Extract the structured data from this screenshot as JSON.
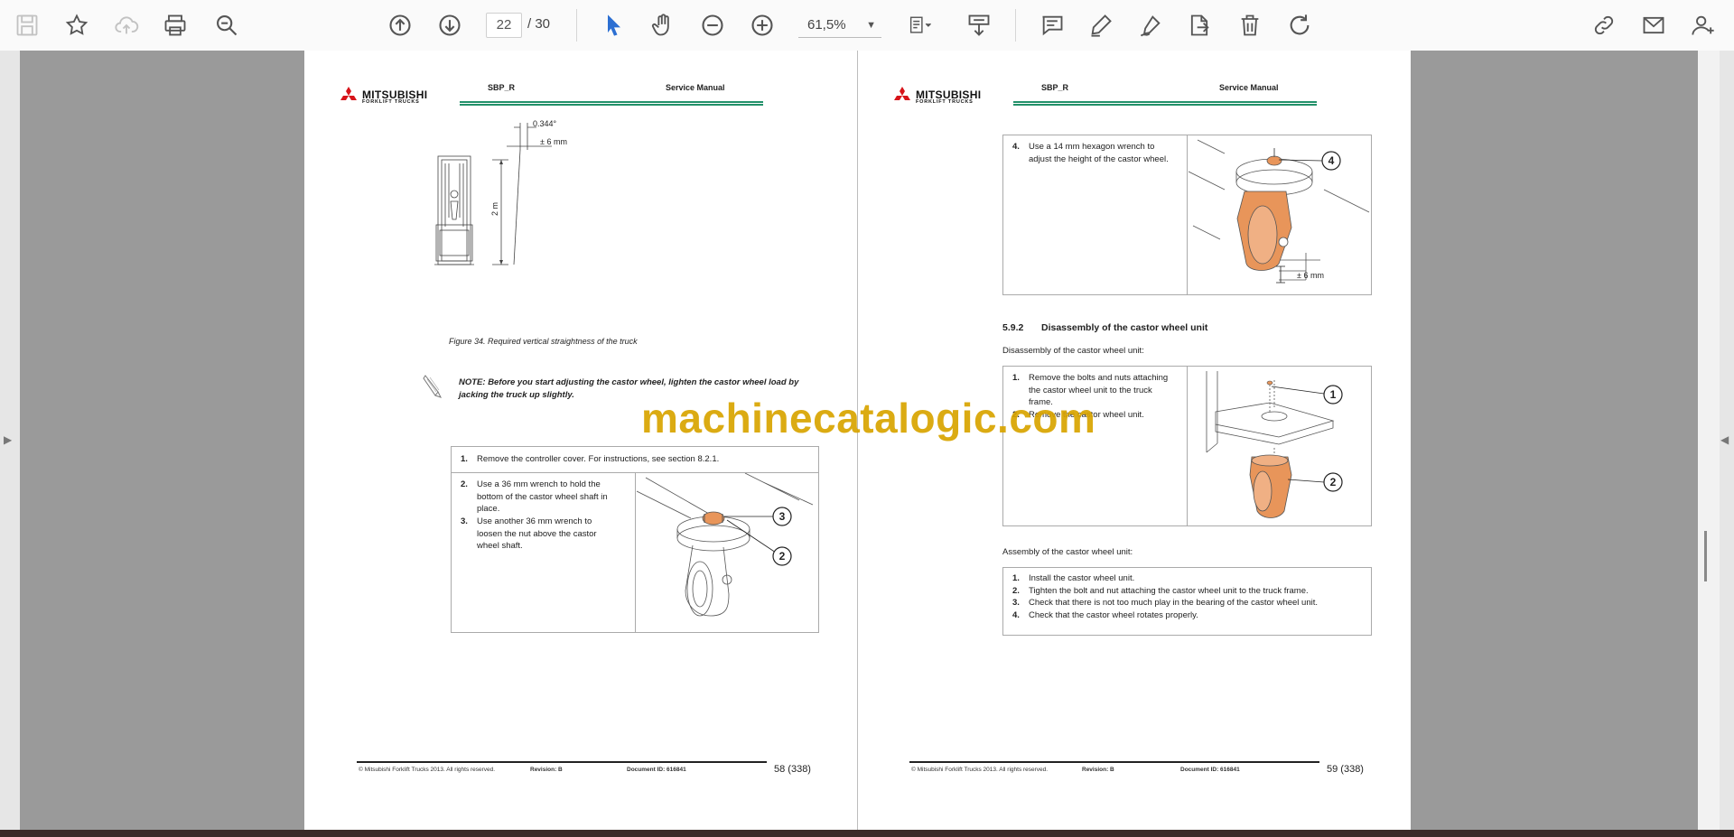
{
  "toolbar": {
    "page_current": "22",
    "page_total": "/ 30",
    "zoom": "61,5%",
    "icons": [
      "save-icon",
      "star-icon",
      "cloud-upload-icon",
      "print-icon",
      "zoom-search-icon",
      "page-up-icon",
      "page-down-icon",
      "select-cursor-icon",
      "hand-icon",
      "zoom-out-icon",
      "zoom-in-icon",
      "page-fit-icon",
      "scroll-mode-icon",
      "comment-icon",
      "highlight-pen-icon",
      "sign-icon",
      "export-icon",
      "delete-icon",
      "rotate-icon",
      "share-link-icon",
      "email-icon",
      "add-user-icon"
    ]
  },
  "left_page": {
    "brand_line1": "MITSUBISHI",
    "brand_line2": "FORKLIFT TRUCKS",
    "doc_code": "SBP_R",
    "doc_title": "Service Manual",
    "figure_dim_top": "0.344°",
    "figure_dim_tol": "± 6 mm",
    "figure_dim_height": "2 m",
    "figure_caption": "Figure 34. Required vertical straightness of the truck",
    "note_line1": "NOTE: Before you start adjusting the castor wheel, lighten the castor wheel load by",
    "note_line2": "jacking the truck up slightly.",
    "step1_num": "1.",
    "step1_text": "Remove the controller cover. For instructions, see section 8.2.1.",
    "step2_num": "2.",
    "step2_lines": [
      "Use a 36 mm wrench to hold the",
      "bottom of the castor wheel shaft in",
      "place."
    ],
    "step3_num": "3.",
    "step3_lines": [
      "Use another 36 mm wrench to",
      "loosen the nut above the castor",
      "wheel shaft."
    ],
    "callouts": [
      "3",
      "2"
    ],
    "footer_copy": "© Mitsubishi Forklift Trucks 2013. All rights reserved.",
    "footer_rev": "Revision: B",
    "footer_doc": "Document ID: 616841",
    "page_number": "58 (338)"
  },
  "right_page": {
    "brand_line1": "MITSUBISHI",
    "brand_line2": "FORKLIFT TRUCKS",
    "doc_code": "SBP_R",
    "doc_title": "Service Manual",
    "step4_num": "4.",
    "step4_lines": [
      "Use a 14 mm hexagon wrench to",
      "adjust the height of the castor wheel."
    ],
    "callout_4": "4",
    "dim_tol": "± 6 mm",
    "section_num": "5.9.2",
    "section_title": "Disassembly of the castor wheel unit",
    "disassembly_intro": "Disassembly of the castor wheel unit:",
    "dis_step1_num": "1.",
    "dis_step1_lines": [
      "Remove the bolts and nuts attaching",
      "the castor wheel unit to the truck",
      "frame."
    ],
    "dis_step2_num": "2.",
    "dis_step2_text": "Remove the castor wheel unit.",
    "dis_callouts": [
      "1",
      "2"
    ],
    "assembly_intro": "Assembly of the castor wheel unit:",
    "assembly_steps": [
      {
        "num": "1.",
        "text": "Install the castor wheel unit."
      },
      {
        "num": "2.",
        "text": "Tighten the bolt and nut attaching the castor wheel unit to the truck frame."
      },
      {
        "num": "3.",
        "text": "Check that there is not too much play in the bearing of the castor wheel unit."
      },
      {
        "num": "4.",
        "text": "Check that the castor wheel rotates properly."
      }
    ],
    "footer_copy": "© Mitsubishi Forklift Trucks 2013. All rights reserved.",
    "footer_rev": "Revision: B",
    "footer_doc": "Document ID: 616841",
    "page_number": "59 (338)"
  },
  "watermark": "machinecatalogic.com",
  "colors": {
    "accent_green": "#23916a",
    "brand_red": "#d7141a",
    "select_blue": "#2c6fd2",
    "watermark_gold": "#d9a400",
    "part_orange": "#e8955a"
  }
}
